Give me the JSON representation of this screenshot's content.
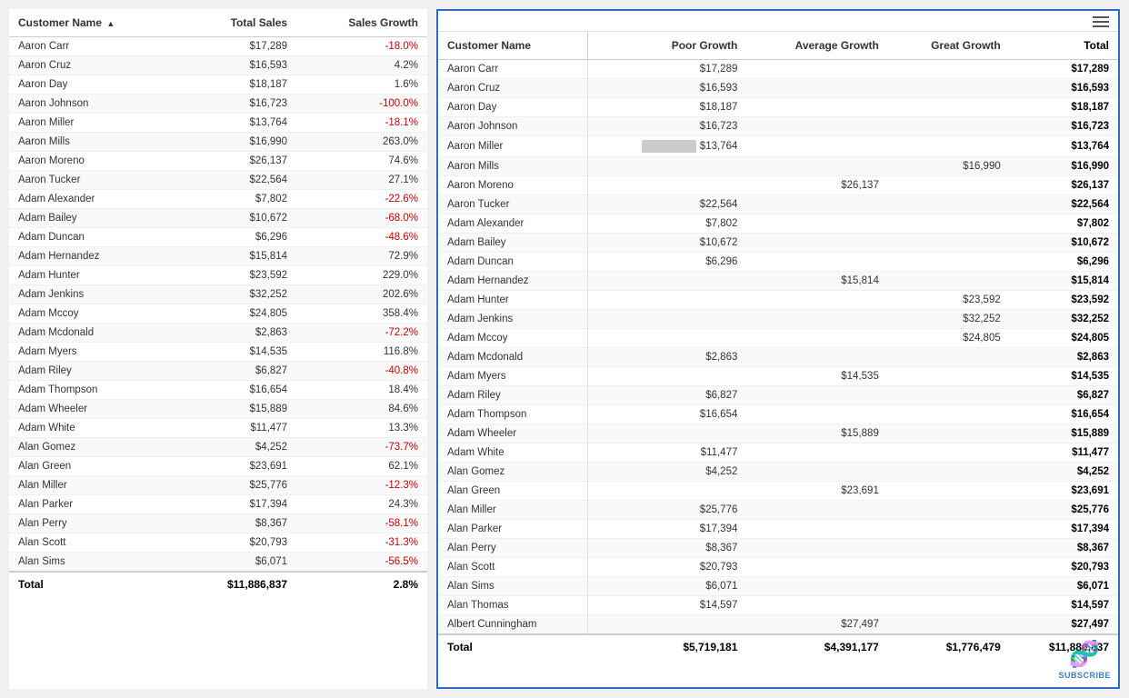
{
  "leftTable": {
    "columns": [
      "Customer Name",
      "Total Sales",
      "Sales Growth"
    ],
    "sortColumn": "Customer Name",
    "sortDirection": "asc",
    "rows": [
      [
        "Aaron Carr",
        "$17,289",
        "-18.0%"
      ],
      [
        "Aaron Cruz",
        "$16,593",
        "4.2%"
      ],
      [
        "Aaron Day",
        "$18,187",
        "1.6%"
      ],
      [
        "Aaron Johnson",
        "$16,723",
        "-100.0%"
      ],
      [
        "Aaron Miller",
        "$13,764",
        "-18.1%"
      ],
      [
        "Aaron Mills",
        "$16,990",
        "263.0%"
      ],
      [
        "Aaron Moreno",
        "$26,137",
        "74.6%"
      ],
      [
        "Aaron Tucker",
        "$22,564",
        "27.1%"
      ],
      [
        "Adam Alexander",
        "$7,802",
        "-22.6%"
      ],
      [
        "Adam Bailey",
        "$10,672",
        "-68.0%"
      ],
      [
        "Adam Duncan",
        "$6,296",
        "-48.6%"
      ],
      [
        "Adam Hernandez",
        "$15,814",
        "72.9%"
      ],
      [
        "Adam Hunter",
        "$23,592",
        "229.0%"
      ],
      [
        "Adam Jenkins",
        "$32,252",
        "202.6%"
      ],
      [
        "Adam Mccoy",
        "$24,805",
        "358.4%"
      ],
      [
        "Adam Mcdonald",
        "$2,863",
        "-72.2%"
      ],
      [
        "Adam Myers",
        "$14,535",
        "116.8%"
      ],
      [
        "Adam Riley",
        "$6,827",
        "-40.8%"
      ],
      [
        "Adam Thompson",
        "$16,654",
        "18.4%"
      ],
      [
        "Adam Wheeler",
        "$15,889",
        "84.6%"
      ],
      [
        "Adam White",
        "$11,477",
        "13.3%"
      ],
      [
        "Alan Gomez",
        "$4,252",
        "-73.7%"
      ],
      [
        "Alan Green",
        "$23,691",
        "62.1%"
      ],
      [
        "Alan Miller",
        "$25,776",
        "-12.3%"
      ],
      [
        "Alan Parker",
        "$17,394",
        "24.3%"
      ],
      [
        "Alan Perry",
        "$8,367",
        "-58.1%"
      ],
      [
        "Alan Scott",
        "$20,793",
        "-31.3%"
      ],
      [
        "Alan Sims",
        "$6,071",
        "-56.5%"
      ]
    ],
    "footer": [
      "Total",
      "$11,886,837",
      "2.8%"
    ]
  },
  "rightTable": {
    "columns": [
      "Customer Name",
      "Poor Growth",
      "Average Growth",
      "Great Growth",
      "Total"
    ],
    "rows": [
      [
        "Aaron Carr",
        "$17,289",
        "",
        "",
        "$17,289",
        "poor"
      ],
      [
        "Aaron Cruz",
        "$16,593",
        "",
        "",
        "$16,593",
        "poor"
      ],
      [
        "Aaron Day",
        "$18,187",
        "",
        "",
        "$18,187",
        "poor"
      ],
      [
        "Aaron Johnson",
        "$16,723",
        "",
        "",
        "$16,723",
        "poor"
      ],
      [
        "Aaron Miller",
        "$13,764",
        "",
        "",
        "$13,764",
        "poor-bar"
      ],
      [
        "Aaron Mills",
        "",
        "",
        "$16,990",
        "$16,990",
        "great"
      ],
      [
        "Aaron Moreno",
        "",
        "$26,137",
        "",
        "$26,137",
        "avg"
      ],
      [
        "Aaron Tucker",
        "$22,564",
        "",
        "",
        "$22,564",
        "poor"
      ],
      [
        "Adam Alexander",
        "$7,802",
        "",
        "",
        "$7,802",
        "poor"
      ],
      [
        "Adam Bailey",
        "$10,672",
        "",
        "",
        "$10,672",
        "poor"
      ],
      [
        "Adam Duncan",
        "$6,296",
        "",
        "",
        "$6,296",
        "poor"
      ],
      [
        "Adam Hernandez",
        "",
        "$15,814",
        "",
        "$15,814",
        "avg"
      ],
      [
        "Adam Hunter",
        "",
        "",
        "$23,592",
        "$23,592",
        "great"
      ],
      [
        "Adam Jenkins",
        "",
        "",
        "$32,252",
        "$32,252",
        "great"
      ],
      [
        "Adam Mccoy",
        "",
        "",
        "$24,805",
        "$24,805",
        "great"
      ],
      [
        "Adam Mcdonald",
        "$2,863",
        "",
        "",
        "$2,863",
        "poor"
      ],
      [
        "Adam Myers",
        "",
        "$14,535",
        "",
        "$14,535",
        "avg"
      ],
      [
        "Adam Riley",
        "$6,827",
        "",
        "",
        "$6,827",
        "poor"
      ],
      [
        "Adam Thompson",
        "$16,654",
        "",
        "",
        "$16,654",
        "poor"
      ],
      [
        "Adam Wheeler",
        "",
        "$15,889",
        "",
        "$15,889",
        "avg"
      ],
      [
        "Adam White",
        "$11,477",
        "",
        "",
        "$11,477",
        "poor"
      ],
      [
        "Alan Gomez",
        "$4,252",
        "",
        "",
        "$4,252",
        "poor"
      ],
      [
        "Alan Green",
        "",
        "$23,691",
        "",
        "$23,691",
        "avg"
      ],
      [
        "Alan Miller",
        "$25,776",
        "",
        "",
        "$25,776",
        "poor"
      ],
      [
        "Alan Parker",
        "$17,394",
        "",
        "",
        "$17,394",
        "poor"
      ],
      [
        "Alan Perry",
        "$8,367",
        "",
        "",
        "$8,367",
        "poor"
      ],
      [
        "Alan Scott",
        "$20,793",
        "",
        "",
        "$20,793",
        "poor"
      ],
      [
        "Alan Sims",
        "$6,071",
        "",
        "",
        "$6,071",
        "poor"
      ],
      [
        "Alan Thomas",
        "$14,597",
        "",
        "",
        "$14,597",
        "poor"
      ],
      [
        "Albert Cunningham",
        "",
        "$27,497",
        "",
        "$27,497",
        "avg"
      ]
    ],
    "footer": [
      "Total",
      "$5,719,181",
      "$4,391,177",
      "$1,776,479",
      "$11,886,837"
    ]
  },
  "icons": {
    "hamburger": "≡",
    "dna": "🧬",
    "subscribe": "SUBSCRIBE",
    "scrollUp": "▲",
    "scrollDown": "▼"
  }
}
